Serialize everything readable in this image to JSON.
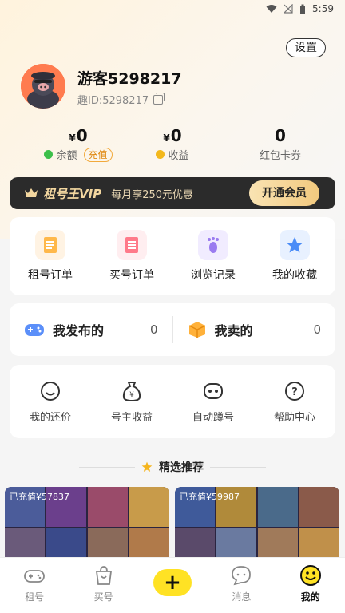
{
  "status": {
    "time": "5:59",
    "icons": [
      "wifi-icon",
      "signal-icon",
      "battery-icon"
    ]
  },
  "header": {
    "settings_label": "设置"
  },
  "profile": {
    "username": "游客5298217",
    "uid": "趣ID:5298217"
  },
  "stats": [
    {
      "currency": "¥",
      "value": "0",
      "label": "余额",
      "action": "充值"
    },
    {
      "currency": "¥",
      "value": "0",
      "label": "收益"
    },
    {
      "currency": "",
      "value": "0",
      "label": "红包卡券"
    }
  ],
  "vip": {
    "title": "租号王VIP",
    "desc": "每月享250元优惠",
    "button": "开通会员"
  },
  "orders": [
    {
      "label": "租号订单",
      "icon": "rent-order-icon",
      "color": "#ffb84a",
      "bg": "#fff3e3"
    },
    {
      "label": "买号订单",
      "icon": "buy-order-icon",
      "color": "#ff7a8a",
      "bg": "#ffeef0"
    },
    {
      "label": "浏览记录",
      "icon": "footprint-icon",
      "color": "#9a7bf0",
      "bg": "#f1ecff"
    },
    {
      "label": "我的收藏",
      "icon": "star-icon",
      "color": "#4a8cf7",
      "bg": "#e8f1ff"
    }
  ],
  "publish": [
    {
      "label": "我发布的",
      "count": "0",
      "icon": "gamepad-icon"
    },
    {
      "label": "我卖的",
      "count": "0",
      "icon": "box-icon"
    }
  ],
  "tools": [
    {
      "label": "我的还价",
      "icon": "bargain-icon"
    },
    {
      "label": "号主收益",
      "icon": "money-bag-icon"
    },
    {
      "label": "自动蹲号",
      "icon": "robot-icon"
    },
    {
      "label": "帮助中心",
      "icon": "help-icon"
    }
  ],
  "recommend": {
    "title": "精选推荐"
  },
  "listings": [
    {
      "label": "已充值¥57837"
    },
    {
      "label": "已充值¥59987"
    }
  ],
  "tabs": [
    {
      "label": "租号",
      "icon": "gamepad-tab-icon"
    },
    {
      "label": "买号",
      "icon": "bag-tab-icon"
    },
    {
      "label": "",
      "icon": "plus-icon"
    },
    {
      "label": "消息",
      "icon": "message-tab-icon"
    },
    {
      "label": "我的",
      "icon": "smiley-tab-icon"
    }
  ],
  "colors": {
    "accent": "#ffe224",
    "vip_bg": "#2b2b2b",
    "recharge": "#e08a13"
  }
}
